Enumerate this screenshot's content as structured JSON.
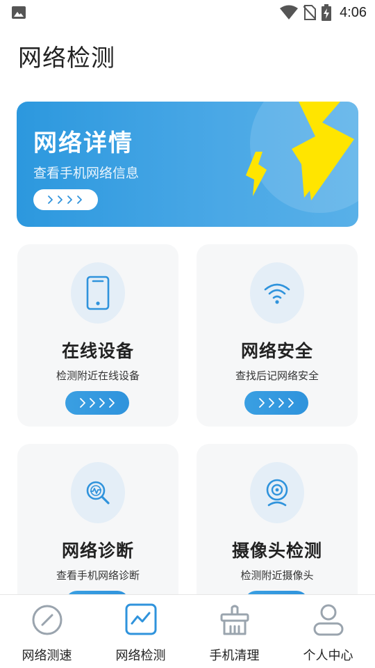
{
  "status_bar": {
    "time": "4:06"
  },
  "page": {
    "title": "网络检测"
  },
  "banner": {
    "title": "网络详情",
    "subtitle": "查看手机网络信息"
  },
  "cards": [
    {
      "title": "在线设备",
      "desc": "检测附近在线设备",
      "icon": "phone-icon"
    },
    {
      "title": "网络安全",
      "desc": "查找后记网络安全",
      "icon": "wifi-icon"
    },
    {
      "title": "网络诊断",
      "desc": "查看手机网络诊断",
      "icon": "diagnose-icon"
    },
    {
      "title": "摄像头检测",
      "desc": "检测附近摄像头",
      "icon": "camera-icon"
    }
  ],
  "bottom_nav": [
    {
      "label": "网络测速",
      "icon": "speedometer-icon",
      "active": false
    },
    {
      "label": "网络检测",
      "icon": "line-chart-icon",
      "active": true
    },
    {
      "label": "手机清理",
      "icon": "broom-icon",
      "active": false
    },
    {
      "label": "个人中心",
      "icon": "user-icon",
      "active": false
    }
  ],
  "colors": {
    "accent": "#2f93dc",
    "bolt": "#ffe500",
    "card_bg": "#f6f7f8"
  }
}
